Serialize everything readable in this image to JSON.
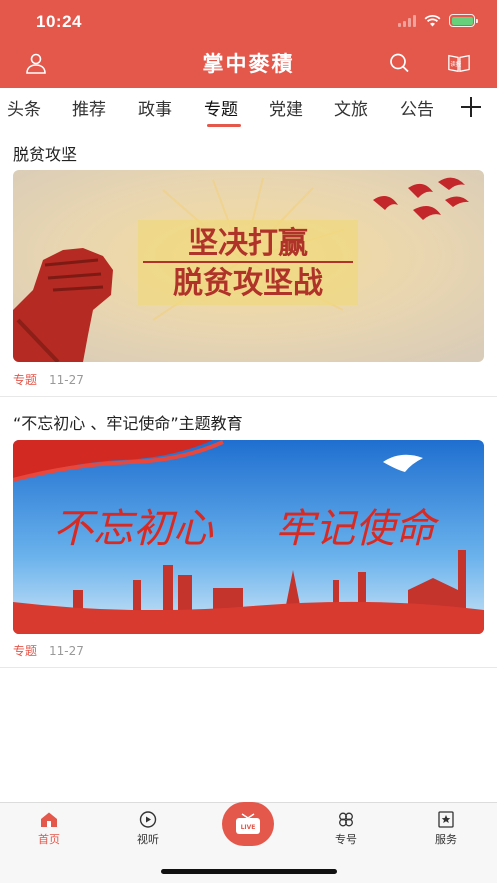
{
  "status_bar": {
    "time": "10:24"
  },
  "header": {
    "title": "掌中麥積",
    "book_icon_text": "读报"
  },
  "tabs": [
    "头条",
    "推荐",
    "政事",
    "专题",
    "党建",
    "文旅",
    "公告"
  ],
  "active_tab": "专题",
  "articles": [
    {
      "title": "脱贫攻坚",
      "banner_text": [
        "坚决打赢",
        "脱贫攻坚战"
      ],
      "tag": "专题",
      "date": "11-27"
    },
    {
      "title": "“不忘初心 、牢记使命”主题教育",
      "banner_text": [
        "不忘初心",
        "牢记使命"
      ],
      "tag": "专题",
      "date": "11-27"
    }
  ],
  "bottom_nav": {
    "items": [
      {
        "label": "首页",
        "icon": "home-icon"
      },
      {
        "label": "视听",
        "icon": "play-icon"
      },
      {
        "label": "",
        "icon": "live-icon",
        "badge": "LIVE"
      },
      {
        "label": "专号",
        "icon": "flower-icon"
      },
      {
        "label": "服务",
        "icon": "star-card-icon"
      }
    ]
  },
  "colors": {
    "brand": "#e4574b",
    "active_label": "#e4574b"
  }
}
